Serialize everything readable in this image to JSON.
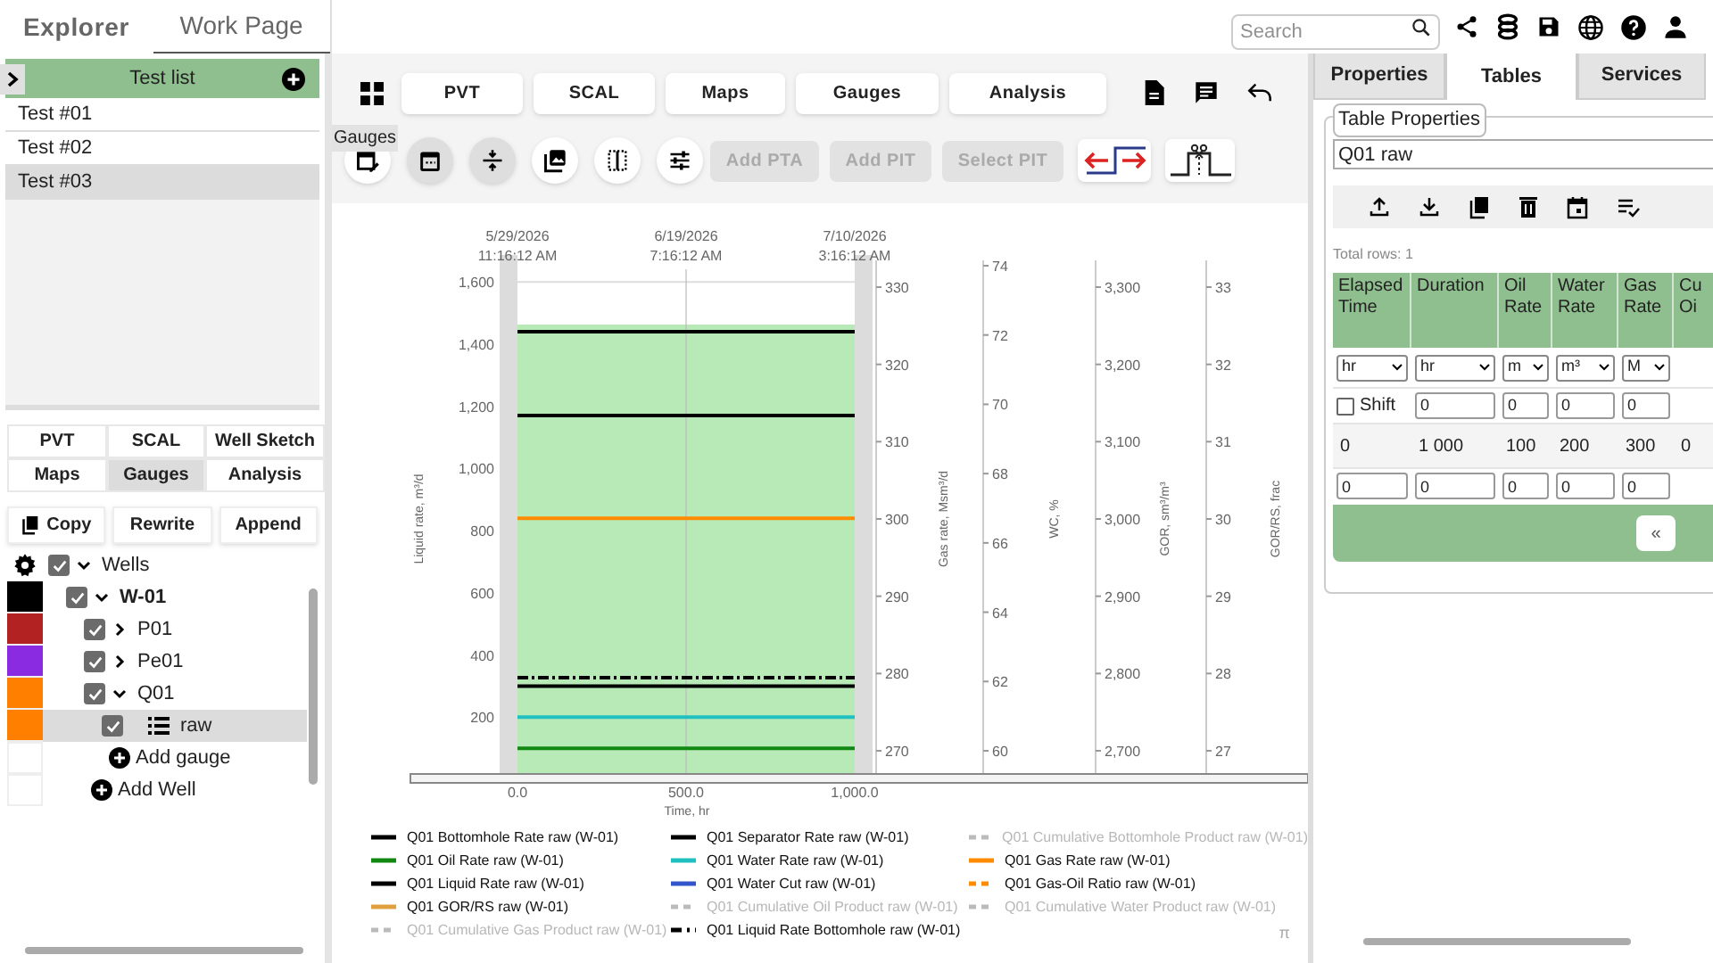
{
  "nav_tabs": [
    {
      "label": "Explorer",
      "selected": false
    },
    {
      "label": "Work Page",
      "selected": true
    }
  ],
  "search": {
    "placeholder": "Search"
  },
  "test_list": {
    "title": "Test list",
    "items": [
      {
        "label": "Test #01",
        "selected": false
      },
      {
        "label": "Test #02",
        "selected": false
      },
      {
        "label": "Test #03",
        "selected": true
      }
    ]
  },
  "module_tabs": [
    {
      "label": "PVT",
      "selected": false
    },
    {
      "label": "SCAL",
      "selected": false
    },
    {
      "label": "Well Sketch",
      "selected": false
    },
    {
      "label": "Maps",
      "selected": false
    },
    {
      "label": "Gauges",
      "selected": true
    },
    {
      "label": "Analysis",
      "selected": false
    }
  ],
  "actions": [
    "Copy",
    "Rewrite",
    "Append"
  ],
  "tree": {
    "kind": "root",
    "label": "Wells",
    "checked": true,
    "expanded": true,
    "children": [
      {
        "kind": "well",
        "label": "W-01",
        "color": "#000000",
        "checked": true,
        "expanded": true,
        "children": [
          {
            "kind": "test",
            "label": "P01",
            "color": "#b22222",
            "checked": true,
            "expanded": false
          },
          {
            "kind": "test",
            "label": "Pe01",
            "color": "#8a2be2",
            "checked": true,
            "expanded": false
          },
          {
            "kind": "test",
            "label": "Q01",
            "color": "#ff8000",
            "checked": true,
            "expanded": true,
            "children": [
              {
                "kind": "gauge",
                "label": "raw",
                "color": "#ff8000",
                "checked": true,
                "selected": true
              }
            ]
          },
          {
            "kind": "add",
            "label": "Add gauge"
          }
        ]
      },
      {
        "kind": "add",
        "label": "Add Well"
      }
    ]
  },
  "main_tabs": [
    "PVT",
    "SCAL",
    "Maps",
    "Gauges",
    "Analysis"
  ],
  "tooltip": "Gauges",
  "round_tools": [
    {
      "on": false
    },
    {
      "on": true
    },
    {
      "on": true
    },
    {
      "on": false
    },
    {
      "on": false
    },
    {
      "on": false
    }
  ],
  "tool_buttons": [
    {
      "label": "Add PTA",
      "disabled": true
    },
    {
      "label": "Add PIT",
      "disabled": true
    },
    {
      "label": "Select PIT",
      "disabled": true
    }
  ],
  "chart": {
    "date_ticks": [
      {
        "date": "5/29/2026",
        "time": "11:16:12 AM"
      },
      {
        "date": "6/19/2026",
        "time": "7:16:12 AM"
      },
      {
        "date": "7/10/2026",
        "time": "3:16:12 AM"
      }
    ],
    "chart_data": {
      "type": "line",
      "xlabel": "Time, hr",
      "ylabel": "Liquid rate, m³/d",
      "x": [
        0,
        1000
      ],
      "xlim": [
        0,
        1000
      ],
      "ylim": [
        0,
        1612
      ],
      "xticks": [
        {
          "value": 0,
          "label": "0.0"
        },
        {
          "value": 500,
          "label": "500.0"
        },
        {
          "value": 1000,
          "label": "1,000.0"
        }
      ],
      "yticks": [
        {
          "value": 200,
          "label": "200"
        },
        {
          "value": 400,
          "label": "400"
        },
        {
          "value": 600,
          "label": "600"
        },
        {
          "value": 800,
          "label": "800"
        },
        {
          "value": 1000,
          "label": "1,000"
        },
        {
          "value": 1200,
          "label": "1,200"
        },
        {
          "value": 1400,
          "label": "1,400"
        },
        {
          "value": 1600,
          "label": "1,600"
        }
      ],
      "bands": [
        {
          "axis": "x",
          "from": 0,
          "to": 1000
        }
      ],
      "ref_lines": [
        {
          "axis": "x",
          "value": 500
        }
      ],
      "series": [
        {
          "name": "Q01 Bottomhole Rate raw (W-01)",
          "color": "#000000",
          "values": [
            1440,
            1440
          ]
        },
        {
          "name": "Q01 Separator Rate raw (W-01)",
          "color": "#000000",
          "values": [
            1170,
            1170
          ]
        },
        {
          "name": "Q01 Cumulative Bottomhole Product raw (W-01)",
          "color": "#bbbbbb",
          "line_style": "dashed",
          "values": [
            null,
            null
          ]
        },
        {
          "name": "Q01 Oil Rate raw (W-01)",
          "color": "#118811",
          "values": [
            100,
            100
          ]
        },
        {
          "name": "Q01 Water Rate raw (W-01)",
          "color": "#20c0c0",
          "values": [
            200,
            200
          ]
        },
        {
          "name": "Q01 Gas Rate raw (W-01)",
          "color": "#ff8c00",
          "values": [
            840,
            840
          ]
        },
        {
          "name": "Q01 Liquid Rate raw (W-01)",
          "color": "#000000",
          "values": [
            300,
            300
          ]
        },
        {
          "name": "Q01 Water Cut raw (W-01)",
          "color": "#3355cc",
          "values": [
            null,
            null
          ]
        },
        {
          "name": "Q01 Gas-Oil Ratio raw (W-01)",
          "color": "#ff8c00",
          "line_style": "dashed",
          "values": [
            null,
            null
          ]
        },
        {
          "name": "Q01 GOR/RS raw (W-01)",
          "color": "#e0a040",
          "values": [
            null,
            null
          ]
        },
        {
          "name": "Q01 Cumulative Oil Product raw (W-01)",
          "color": "#bbbbbb",
          "line_style": "dashed",
          "values": [
            null,
            null
          ]
        },
        {
          "name": "Q01 Cumulative Water Product raw (W-01)",
          "color": "#bbbbbb",
          "line_style": "dashed",
          "values": [
            null,
            null
          ]
        },
        {
          "name": "Q01 Cumulative Gas Product raw (W-01)",
          "color": "#bbbbbb",
          "line_style": "dashed",
          "values": [
            null,
            null
          ]
        },
        {
          "name": "Q01 Liquid Rate Bottomhole raw (W-01)",
          "color": "#000000",
          "line_style": "dashdot",
          "values": [
            327,
            327
          ]
        }
      ]
    },
    "legend": [
      {
        "hidden": false
      },
      {
        "hidden": false
      },
      {
        "hidden": true
      },
      {
        "hidden": false
      },
      {
        "hidden": false
      },
      {
        "hidden": false
      },
      {
        "hidden": false
      },
      {
        "hidden": false
      },
      {
        "hidden": false
      },
      {
        "hidden": false
      },
      {
        "hidden": true
      },
      {
        "hidden": true
      },
      {
        "hidden": true
      },
      {
        "hidden": false
      }
    ],
    "extra_axes": [
      {
        "title": "Gas rate, Msm³/d",
        "ticks": [
          "330",
          "320",
          "310",
          "300",
          "290",
          "280",
          "270"
        ]
      },
      {
        "title": "WC, %",
        "ticks": [
          "74",
          "72",
          "70",
          "68",
          "66",
          "64",
          "62",
          "60"
        ]
      },
      {
        "title": "GOR, sm³/m³",
        "ticks": [
          "3,300",
          "3,200",
          "3,100",
          "3,000",
          "2,900",
          "2,800",
          "2,700"
        ]
      },
      {
        "title": "GOR/RS, frac",
        "ticks": [
          "33",
          "32",
          "31",
          "30",
          "29",
          "28",
          "27"
        ]
      }
    ],
    "corner_mark": "π"
  },
  "side_tabs": [
    {
      "label": "Properties",
      "selected": false
    },
    {
      "label": "Tables",
      "selected": true
    },
    {
      "label": "Services",
      "selected": false
    }
  ],
  "table_properties": {
    "legend": "Table Properties",
    "name_value": "Q01 raw",
    "total_rows": "Total rows: 1",
    "columns": [
      "Elapsed Time",
      "Duration",
      "Oil Rate",
      "Water Rate",
      "Gas Rate",
      "Cu Oi"
    ],
    "units": [
      "hr",
      "hr",
      "m",
      "m³",
      "M"
    ],
    "shift": {
      "label": "Shift",
      "checked": false
    },
    "shift_values": [
      "0",
      "0",
      "0",
      "0"
    ],
    "rows": [
      [
        "0",
        "1 000",
        "100",
        "200",
        "300",
        "0"
      ]
    ],
    "new_row": [
      "0",
      "0",
      "0",
      "0",
      "0"
    ],
    "pager": "«"
  }
}
